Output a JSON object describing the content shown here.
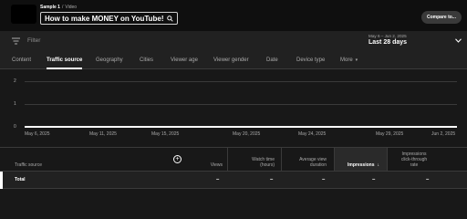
{
  "header": {
    "breadcrumb_channel": "Sample 1",
    "breadcrumb_separator": "/",
    "breadcrumb_type": "Video",
    "video_title": "How to make MONEY on YouTube!",
    "compare_label": "Compare to..."
  },
  "filter": {
    "placeholder": "Filter",
    "date_range_sub": "May 6 – Jun 2, 2025",
    "date_range_main": "Last 28 days"
  },
  "tabs": [
    {
      "label": "Content"
    },
    {
      "label": "Traffic source",
      "active": true
    },
    {
      "label": "Geography"
    },
    {
      "label": "Cities"
    },
    {
      "label": "Viewer age"
    },
    {
      "label": "Viewer gender"
    },
    {
      "label": "Date"
    },
    {
      "label": "Device type"
    },
    {
      "label": "More"
    }
  ],
  "chart_data": {
    "type": "line",
    "y_ticks": [
      "2",
      "1",
      "0"
    ],
    "ylim": [
      0,
      2
    ],
    "x_ticks": [
      "May 6, 2025",
      "May 11, 2025",
      "May 15, 2025",
      "May 20, 2025",
      "May 24, 2025",
      "May 29, 2025",
      "Jun 2, 2025"
    ],
    "series": [
      {
        "values": [
          0,
          0,
          0,
          0,
          0,
          0,
          0
        ]
      }
    ],
    "grid": true
  },
  "table": {
    "columns": {
      "dimension": "Traffic source",
      "views": "Views",
      "watch_time_1": "Watch time",
      "watch_time_2": "(hours)",
      "avg_view_1": "Average view",
      "avg_view_2": "duration",
      "impressions": "Impressions",
      "sort_arrow": "↓",
      "ctr_1": "Impressions",
      "ctr_2": "click-through",
      "ctr_3": "rate"
    },
    "total": {
      "label": "Total",
      "views": "–",
      "watch_time": "–",
      "avg_view": "–",
      "impressions": "–",
      "ctr": "–"
    }
  },
  "icons": {
    "search": "search-icon",
    "filter": "filter-icon",
    "chevron": "chevron-down-icon",
    "add_column": "add-column-icon"
  }
}
